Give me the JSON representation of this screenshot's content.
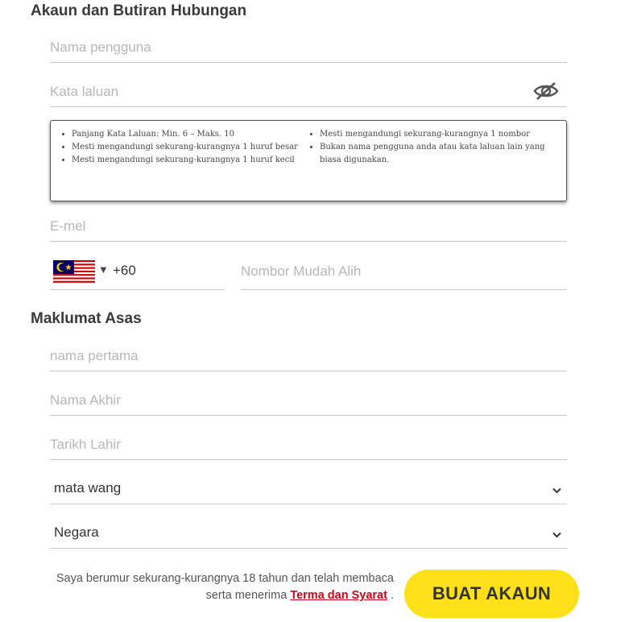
{
  "account": {
    "title": "Akaun dan Butiran Hubungan",
    "username_placeholder": "Nama pengguna",
    "password_placeholder": "Kata laluan",
    "password_rules_left": [
      "Panjang Kata Laluan: Min. 6 – Maks. 10",
      "Mesti mengandungi sekurang-kurangnya 1 huruf besar",
      "Mesti mengandungi sekurang-kurangnya 1 huruf kecil"
    ],
    "password_rules_right": [
      "Mesti mengandungi sekurang-kurangnya 1 nombor",
      "Bukan nama pengguna anda atau kata laluan lain yang biasa digunakan."
    ],
    "email_placeholder": "E-mel",
    "dial_code": "+60",
    "phone_placeholder": "Nombor Mudah Alih",
    "flag_icon": "malaysia-flag-icon"
  },
  "basic": {
    "title": "Maklumat Asas",
    "first_name_placeholder": "nama pertama",
    "last_name_placeholder": "Nama Akhir",
    "dob_placeholder": "Tarikh Lahir",
    "currency_value": "mata wang",
    "country_value": "Negara"
  },
  "footer": {
    "terms_text_before": "Saya berumur sekurang-kurangnya 18 tahun dan telah membaca serta menerima ",
    "terms_link": "Terma dan Syarat",
    "terms_text_after": " .",
    "submit_label": "BUAT AKAUN"
  },
  "colors": {
    "button": "#fde01a",
    "link": "#d0021b"
  }
}
